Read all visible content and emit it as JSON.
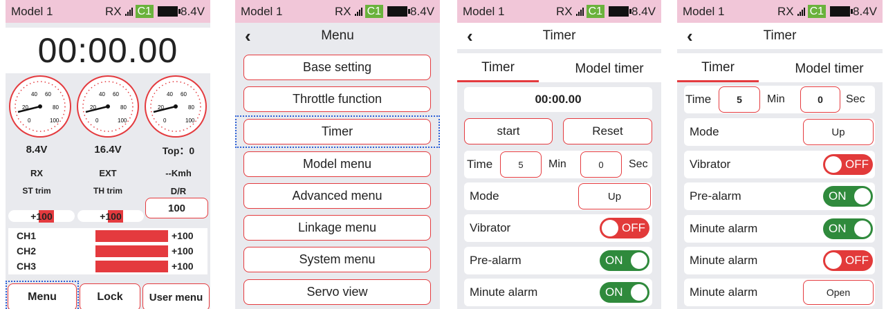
{
  "status": {
    "model": "Model 1",
    "rx": "RX",
    "channel_badge": "C1",
    "voltage": "8.4V"
  },
  "screen1": {
    "clock": "00:00.00",
    "gauges": [
      {
        "ticks": [
          "20",
          "40",
          "60",
          "80",
          "100",
          "0"
        ]
      },
      {
        "ticks": [
          "20",
          "40",
          "60",
          "80",
          "100",
          "0"
        ]
      },
      {
        "ticks": [
          "20",
          "40",
          "60",
          "80",
          "100",
          "0"
        ]
      }
    ],
    "readouts": {
      "rx_voltage": "8.4V",
      "ext_voltage": "16.4V",
      "top_label": "Top：",
      "top_value": "0"
    },
    "labels": {
      "rx": "RX",
      "ext": "EXT",
      "speed": "--Kmh",
      "st_trim": "ST trim",
      "th_trim": "TH trim",
      "dr": "D/R"
    },
    "st_trim_value": "+100",
    "th_trim_value": "+100",
    "dr_value": "100",
    "channels": [
      {
        "name": "CH1",
        "value": "+100",
        "level": 1.0
      },
      {
        "name": "CH2",
        "value": "+100",
        "level": 1.0
      },
      {
        "name": "CH3",
        "value": "+100",
        "level": 1.0
      }
    ],
    "buttons": {
      "menu": "Menu",
      "lock": "Lock",
      "user_menu": "User menu"
    }
  },
  "screen2": {
    "title": "Menu",
    "items": [
      "Base setting",
      "Throttle function",
      "Timer",
      "Model menu",
      "Advanced menu",
      "Linkage menu",
      "System menu",
      "Servo view"
    ]
  },
  "screen3": {
    "title": "Timer",
    "tabs": [
      "Timer",
      "Model timer"
    ],
    "display": "00:00.00",
    "start": "start",
    "reset": "Reset",
    "time_label": "Time",
    "min_value": "5",
    "min_label": "Min",
    "sec_value": "0",
    "sec_label": "Sec",
    "mode_label": "Mode",
    "mode_value": "Up",
    "vibrator_label": "Vibrator",
    "vibrator_state": "OFF",
    "prealarm_label": "Pre-alarm",
    "prealarm_state": "ON",
    "minute_alarm_label": "Minute alarm",
    "minute_alarm_state": "ON"
  },
  "screen4": {
    "title": "Timer",
    "tabs": [
      "Timer",
      "Model timer"
    ],
    "time_label": "Time",
    "min_value": "5",
    "min_label": "Min",
    "sec_value": "0",
    "sec_label": "Sec",
    "mode_label": "Mode",
    "mode_value": "Up",
    "vibrator_label": "Vibrator",
    "vibrator_state": "OFF",
    "prealarm_label": "Pre-alarm",
    "prealarm_state": "ON",
    "minute_alarm1_label": "Minute alarm",
    "minute_alarm1_state": "ON",
    "minute_alarm2_label": "Minute alarm",
    "minute_alarm2_state": "OFF",
    "minute_alarm3_label": "Minute alarm",
    "minute_alarm3_value": "Open"
  }
}
